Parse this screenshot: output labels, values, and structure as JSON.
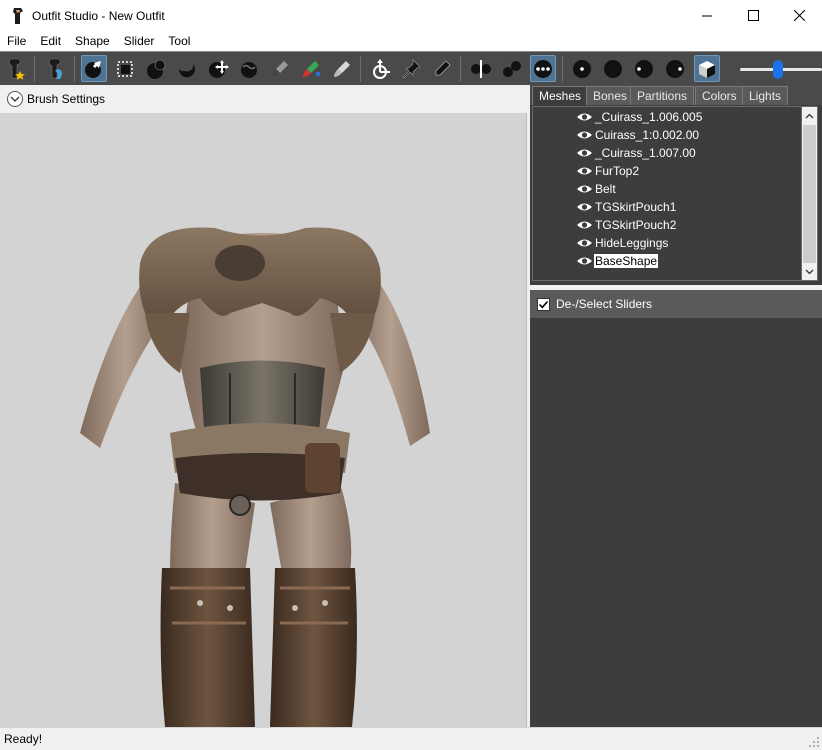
{
  "window": {
    "title": "Outfit Studio - New Outfit"
  },
  "menu": [
    "File",
    "Edit",
    "Shape",
    "Slider",
    "Tool"
  ],
  "toolbar": {
    "tools": [
      {
        "name": "load-reference-icon",
        "active": false
      },
      {
        "name": "load-outfit-icon",
        "active": false
      },
      {
        "name": "select-brush-icon",
        "active": true
      },
      {
        "name": "mask-brush-icon",
        "active": false
      },
      {
        "name": "inflate-brush-icon",
        "active": false
      },
      {
        "name": "deflate-brush-icon",
        "active": false
      },
      {
        "name": "move-brush-icon",
        "active": false
      },
      {
        "name": "smooth-brush-icon",
        "active": false
      },
      {
        "name": "weight-brush-icon",
        "active": false
      },
      {
        "name": "color-brush-icon",
        "active": false
      },
      {
        "name": "alpha-brush-icon",
        "active": false
      },
      {
        "name": "transform-icon",
        "active": false
      },
      {
        "name": "pivot-icon",
        "active": false
      },
      {
        "name": "vertex-edit-icon",
        "active": false
      },
      {
        "name": "mirror-x-icon",
        "active": false
      },
      {
        "name": "connected-only-icon",
        "active": false
      },
      {
        "name": "global-brush-icon",
        "active": true
      },
      {
        "name": "view-front-icon",
        "active": false
      },
      {
        "name": "view-back-icon",
        "active": false
      },
      {
        "name": "view-left-icon",
        "active": false
      },
      {
        "name": "view-right-icon",
        "active": false
      },
      {
        "name": "perspective-icon",
        "active": true
      }
    ],
    "brush_size_level": 0.45
  },
  "brush_settings": {
    "label": "Brush Settings"
  },
  "tabs": [
    {
      "label": "Meshes",
      "active": true
    },
    {
      "label": "Bones",
      "active": false
    },
    {
      "label": "Partitions",
      "active": false
    },
    {
      "label": "Colors",
      "active": false
    },
    {
      "label": "Lights",
      "active": false
    }
  ],
  "meshes": [
    {
      "name": "_Cuirass_1.006.005",
      "selected": false
    },
    {
      "name": "Cuirass_1:0.002.00",
      "selected": false
    },
    {
      "name": "_Cuirass_1.007.00",
      "selected": false
    },
    {
      "name": "FurTop2",
      "selected": false
    },
    {
      "name": "Belt",
      "selected": false
    },
    {
      "name": "TGSkirtPouch1",
      "selected": false
    },
    {
      "name": "TGSkirtPouch2",
      "selected": false
    },
    {
      "name": "HideLeggings",
      "selected": false
    },
    {
      "name": "BaseShape",
      "selected": true
    }
  ],
  "sliders_panel": {
    "label": "De-/Select Sliders",
    "checked": true
  },
  "status": {
    "text": "Ready!"
  },
  "colors": {
    "toolbar_bg": "#4a4a4a",
    "panel_bg": "#3d3d3d",
    "active_tool": "#4f7393",
    "viewport_bg": "#d3d3d3",
    "slider_accent": "#1a73e8"
  }
}
